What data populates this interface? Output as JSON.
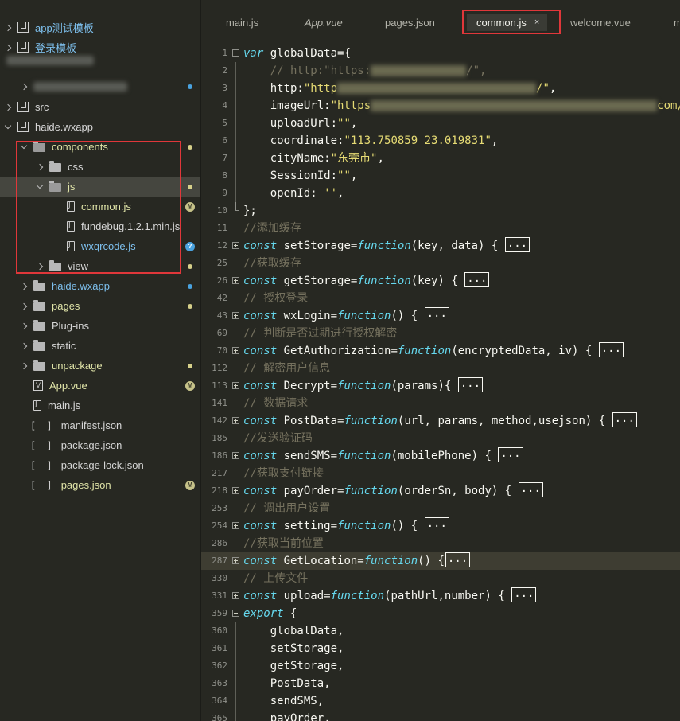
{
  "sidebar": {
    "items": [
      {
        "label": "app测试模板",
        "color": "blue"
      },
      {
        "label": "登录模板",
        "color": "blue"
      },
      {
        "label": "src"
      },
      {
        "label": "haide.wxapp"
      },
      {
        "label": "components"
      },
      {
        "label": "css"
      },
      {
        "label": "js"
      },
      {
        "label": "common.js",
        "badge": "M"
      },
      {
        "label": "fundebug.1.2.1.min.js"
      },
      {
        "label": "wxqrcode.js",
        "badge": "?"
      },
      {
        "label": "view"
      },
      {
        "label": "haide.wxapp"
      },
      {
        "label": "pages"
      },
      {
        "label": "Plug-ins"
      },
      {
        "label": "static"
      },
      {
        "label": "unpackage"
      },
      {
        "label": "App.vue",
        "badge": "M"
      },
      {
        "label": "main.js"
      },
      {
        "label": "manifest.json"
      },
      {
        "label": "package.json"
      },
      {
        "label": "package-lock.json"
      },
      {
        "label": "pages.json",
        "badge": "M"
      }
    ],
    "json_glyph": "[ ]",
    "vue_glyph": "V"
  },
  "tabs": [
    {
      "label": "main.js"
    },
    {
      "label": "App.vue"
    },
    {
      "label": "pages.json"
    },
    {
      "label": "common.js",
      "active": true,
      "close": "×"
    },
    {
      "label": "welcome.vue"
    },
    {
      "label": "m"
    }
  ],
  "code": {
    "lines": [
      {
        "n": "1",
        "fold": "minus",
        "parts": [
          [
            "kw",
            "var"
          ],
          [
            "t",
            " globalData={"
          ]
        ]
      },
      {
        "n": "2",
        "parts": [
          [
            "cm",
            "    // http:\"https:"
          ],
          [
            "cm",
            "/\","
          ]
        ],
        "blur": 1
      },
      {
        "n": "3",
        "parts": [
          [
            "t",
            "    http:"
          ],
          [
            "str",
            "\"http"
          ],
          [
            "str",
            "/\""
          ],
          [
            "t",
            ","
          ]
        ],
        "blur": 2
      },
      {
        "n": "4",
        "parts": [
          [
            "t",
            "    imageUrl:"
          ],
          [
            "str",
            "\"https"
          ],
          [
            "str",
            "com/"
          ]
        ],
        "blur": 3
      },
      {
        "n": "5",
        "parts": [
          [
            "t",
            "    uploadUrl:"
          ],
          [
            "str",
            "\"\""
          ],
          [
            "t",
            ","
          ]
        ]
      },
      {
        "n": "6",
        "parts": [
          [
            "t",
            "    coordinate:"
          ],
          [
            "str",
            "\"113.750859 23.019831\""
          ],
          [
            "t",
            ","
          ]
        ]
      },
      {
        "n": "7",
        "parts": [
          [
            "t",
            "    cityName:"
          ],
          [
            "str",
            "\"东莞市\""
          ],
          [
            "t",
            ","
          ]
        ]
      },
      {
        "n": "8",
        "parts": [
          [
            "t",
            "    SessionId:"
          ],
          [
            "str",
            "\"\""
          ],
          [
            "t",
            ","
          ]
        ]
      },
      {
        "n": "9",
        "parts": [
          [
            "t",
            "    openId: "
          ],
          [
            "str",
            "''"
          ],
          [
            "t",
            ","
          ]
        ]
      },
      {
        "n": "10",
        "fold": "end",
        "parts": [
          [
            "t",
            "};"
          ]
        ]
      },
      {
        "n": "11",
        "parts": [
          [
            "cm",
            "//添加缓存"
          ]
        ]
      },
      {
        "n": "12",
        "fold": "plus",
        "parts": [
          [
            "kw",
            "const"
          ],
          [
            "t",
            " setStorage="
          ],
          [
            "fn",
            "function"
          ],
          [
            "t",
            "(key, data) { "
          ],
          [
            "ell",
            "..."
          ]
        ]
      },
      {
        "n": "25",
        "parts": [
          [
            "cm",
            "//获取缓存"
          ]
        ]
      },
      {
        "n": "26",
        "fold": "plus",
        "parts": [
          [
            "kw",
            "const"
          ],
          [
            "t",
            " getStorage="
          ],
          [
            "fn",
            "function"
          ],
          [
            "t",
            "(key) { "
          ],
          [
            "ell",
            "..."
          ]
        ]
      },
      {
        "n": "42",
        "parts": [
          [
            "cm",
            "// 授权登录"
          ]
        ]
      },
      {
        "n": "43",
        "fold": "plus",
        "parts": [
          [
            "kw",
            "const"
          ],
          [
            "t",
            " wxLogin="
          ],
          [
            "fn",
            "function"
          ],
          [
            "t",
            "() { "
          ],
          [
            "ell",
            "..."
          ]
        ]
      },
      {
        "n": "69",
        "parts": [
          [
            "cm",
            "// 判断是否过期进行授权解密"
          ]
        ]
      },
      {
        "n": "70",
        "fold": "plus",
        "parts": [
          [
            "kw",
            "const"
          ],
          [
            "t",
            " GetAuthorization="
          ],
          [
            "fn",
            "function"
          ],
          [
            "t",
            "(encryptedData, iv) { "
          ],
          [
            "ell",
            "..."
          ]
        ]
      },
      {
        "n": "112",
        "parts": [
          [
            "cm",
            "// 解密用户信息"
          ]
        ]
      },
      {
        "n": "113",
        "fold": "plus",
        "parts": [
          [
            "kw",
            "const"
          ],
          [
            "t",
            " Decrypt="
          ],
          [
            "fn",
            "function"
          ],
          [
            "t",
            "(params){ "
          ],
          [
            "ell",
            "..."
          ]
        ]
      },
      {
        "n": "141",
        "parts": [
          [
            "cm",
            "// 数据请求"
          ]
        ]
      },
      {
        "n": "142",
        "fold": "plus",
        "parts": [
          [
            "kw",
            "const"
          ],
          [
            "t",
            " PostData="
          ],
          [
            "fn",
            "function"
          ],
          [
            "t",
            "(url, params, method,usejson) { "
          ],
          [
            "ell",
            "..."
          ]
        ]
      },
      {
        "n": "185",
        "parts": [
          [
            "cm",
            "//发送验证码"
          ]
        ]
      },
      {
        "n": "186",
        "fold": "plus",
        "parts": [
          [
            "kw",
            "const"
          ],
          [
            "t",
            " sendSMS="
          ],
          [
            "fn",
            "function"
          ],
          [
            "t",
            "(mobilePhone) { "
          ],
          [
            "ell",
            "..."
          ]
        ]
      },
      {
        "n": "217",
        "parts": [
          [
            "cm",
            "//获取支付链接"
          ]
        ]
      },
      {
        "n": "218",
        "fold": "plus",
        "parts": [
          [
            "kw",
            "const"
          ],
          [
            "t",
            " payOrder="
          ],
          [
            "fn",
            "function"
          ],
          [
            "t",
            "(orderSn, body) { "
          ],
          [
            "ell",
            "..."
          ]
        ]
      },
      {
        "n": "253",
        "parts": [
          [
            "cm",
            "// 调出用户设置"
          ]
        ]
      },
      {
        "n": "254",
        "fold": "plus",
        "parts": [
          [
            "kw",
            "const"
          ],
          [
            "t",
            " setting="
          ],
          [
            "fn",
            "function"
          ],
          [
            "t",
            "() { "
          ],
          [
            "ell",
            "..."
          ]
        ]
      },
      {
        "n": "286",
        "parts": [
          [
            "cm",
            "//获取当前位置"
          ]
        ]
      },
      {
        "n": "287",
        "fold": "plus",
        "current": true,
        "parts": [
          [
            "kw",
            "const"
          ],
          [
            "t",
            " GetLocation="
          ],
          [
            "fn",
            "function"
          ],
          [
            "t",
            "() {"
          ],
          [
            "cursor",
            ""
          ],
          [
            "ell",
            "..."
          ]
        ]
      },
      {
        "n": "330",
        "parts": [
          [
            "cm",
            "// 上传文件"
          ]
        ]
      },
      {
        "n": "331",
        "fold": "plus",
        "parts": [
          [
            "kw",
            "const"
          ],
          [
            "t",
            " upload="
          ],
          [
            "fn",
            "function"
          ],
          [
            "t",
            "(pathUrl,number) { "
          ],
          [
            "ell",
            "..."
          ]
        ]
      },
      {
        "n": "359",
        "fold": "minus",
        "parts": [
          [
            "kw",
            "export"
          ],
          [
            "t",
            " {"
          ]
        ]
      },
      {
        "n": "360",
        "guide": true,
        "parts": [
          [
            "t",
            "    globalData,"
          ]
        ]
      },
      {
        "n": "361",
        "guide": true,
        "parts": [
          [
            "t",
            "    setStorage,"
          ]
        ]
      },
      {
        "n": "362",
        "guide": true,
        "parts": [
          [
            "t",
            "    getStorage,"
          ]
        ]
      },
      {
        "n": "363",
        "guide": true,
        "parts": [
          [
            "t",
            "    PostData,"
          ]
        ]
      },
      {
        "n": "364",
        "guide": true,
        "parts": [
          [
            "t",
            "    sendSMS,"
          ]
        ]
      },
      {
        "n": "365",
        "guide": true,
        "parts": [
          [
            "t",
            "    payOrder,"
          ]
        ]
      }
    ]
  },
  "colors": {
    "background": "#272822",
    "keyword": "#66d9ef",
    "string": "#e6db74",
    "comment": "#75715e",
    "highlight": "#e0373a"
  }
}
